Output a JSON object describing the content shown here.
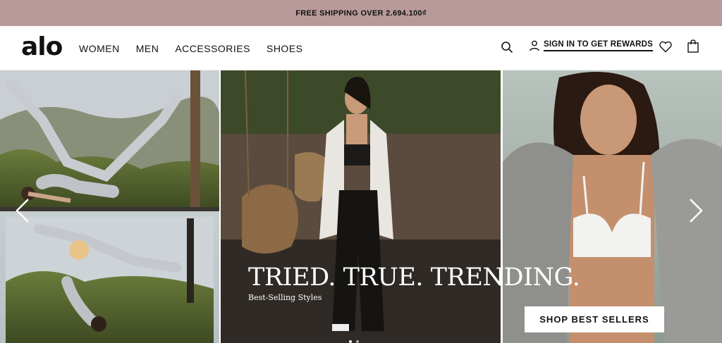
{
  "promo": {
    "text": "FREE SHIPPING OVER 2.694.100₫"
  },
  "header": {
    "logo": "alo",
    "nav": [
      {
        "label": "WOMEN"
      },
      {
        "label": "MEN"
      },
      {
        "label": "ACCESSORIES"
      },
      {
        "label": "SHOES"
      }
    ],
    "search_icon": "search-icon",
    "signin_label": "SIGN IN TO GET REWARDS",
    "wishlist_icon": "heart-icon",
    "bag_icon": "bag-icon"
  },
  "hero": {
    "headline": "TRIED. TRUE. TRENDING.",
    "subline": "Best-Selling Styles",
    "cta_label": "SHOP BEST SELLERS",
    "left_image": "yoga-poses-photo",
    "middle_image": "model-sports-bra-wide-pants-photo",
    "right_image": "model-white-bra-gray-hoodie-photo",
    "prev_icon": "chevron-left-icon",
    "next_icon": "chevron-right-icon"
  },
  "colors": {
    "promo_bg": "#b89a9a",
    "text": "#111111",
    "cta_bg": "#ffffff"
  }
}
